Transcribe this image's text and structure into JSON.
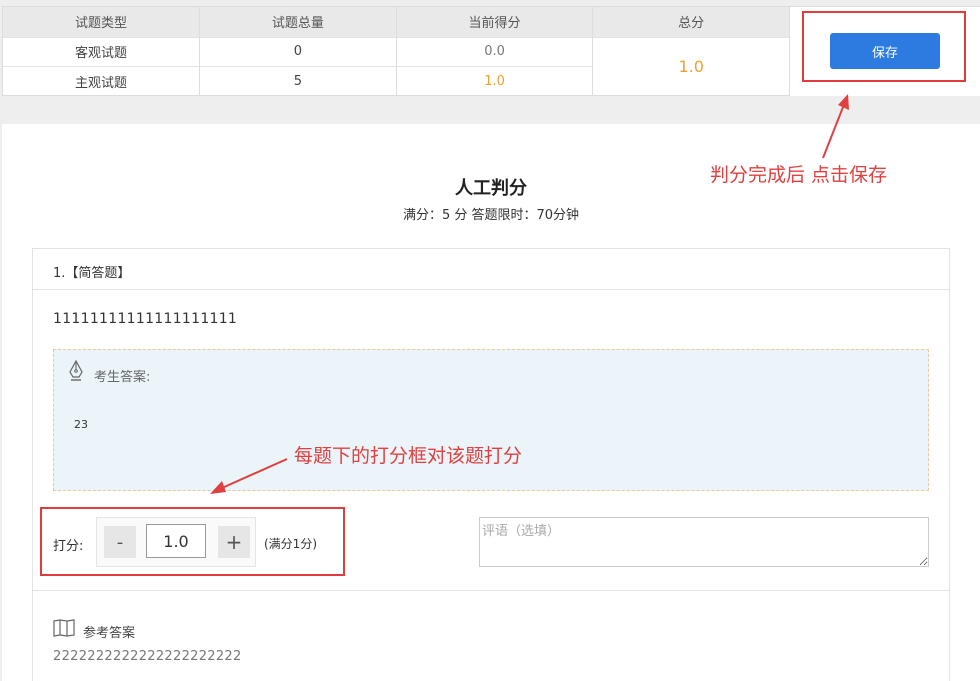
{
  "summary": {
    "headers": [
      "试题类型",
      "试题总量",
      "当前得分",
      "总分"
    ],
    "rows": [
      {
        "type": "客观试题",
        "count": "0",
        "score": "0.0"
      },
      {
        "type": "主观试题",
        "count": "5",
        "score": "1.0"
      }
    ],
    "total": "1.0",
    "save_label": "保存"
  },
  "exam": {
    "title": "人工判分",
    "subtitle": "满分：5 分 答题限时：70分钟"
  },
  "question": {
    "header": "1.【简答题】",
    "text": "11111111111111111111",
    "answer_label": "考生答案:",
    "answer_text": "23",
    "score_label": "打分:",
    "minus": "-",
    "plus": "+",
    "score_value": "1.0",
    "full_score": "(满分1分)",
    "comment_placeholder": "评语（选填）",
    "ref_label": "参考答案",
    "ref_text": "2222222222222222222222"
  },
  "annotations": {
    "save_hint": "判分完成后 点击保存",
    "score_hint": "每题下的打分框对该题打分"
  },
  "colors": {
    "accent": "#2d7be0",
    "highlight": "#f0a030",
    "annotation": "#e04040",
    "answer_bg": "#eaf4f9"
  },
  "icons": [
    "pen-nib-icon",
    "book-icon"
  ]
}
